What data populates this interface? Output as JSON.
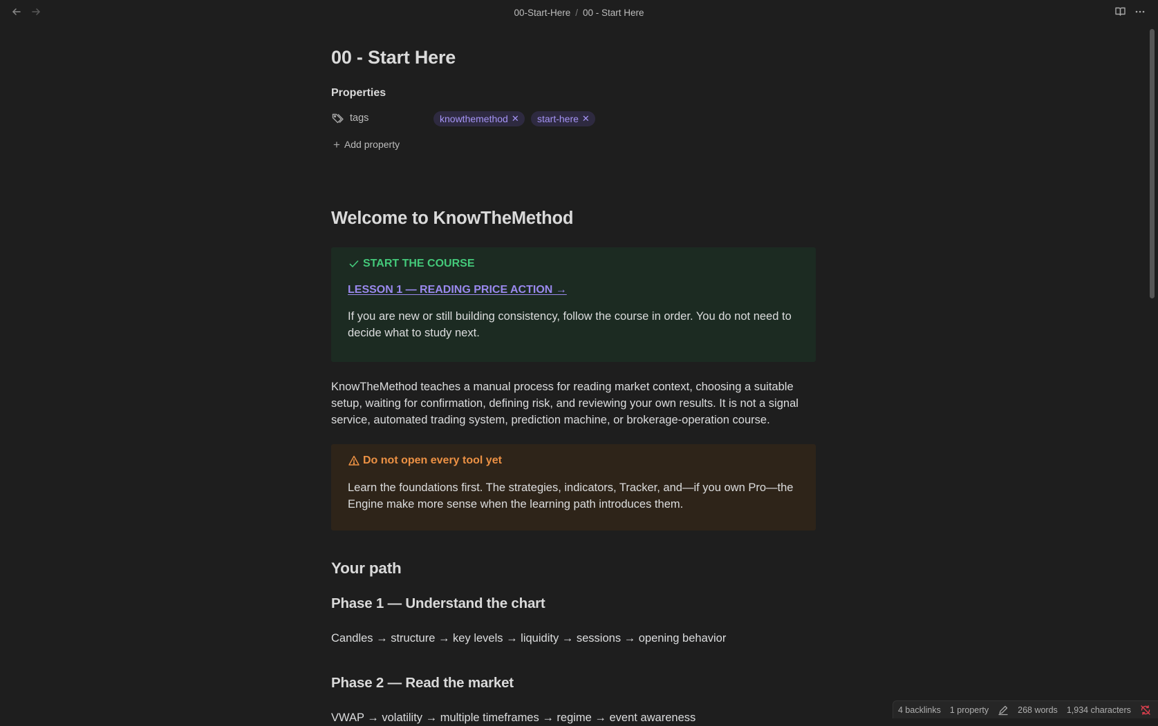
{
  "breadcrumb": {
    "folder": "00-Start-Here",
    "separator": "/",
    "note": "00 - Start Here"
  },
  "note": {
    "title": "00 - Start Here"
  },
  "properties": {
    "heading": "Properties",
    "tags_key": "tags",
    "tags": [
      "knowthemethod",
      "start-here"
    ],
    "add_property_label": "Add property"
  },
  "content": {
    "welcome_heading": "Welcome to KnowTheMethod",
    "course_callout": {
      "title": "START THE COURSE",
      "link": "LESSON 1 — READING PRICE ACTION →",
      "body": "If you are new or still building consistency, follow the course in order. You do not need to decide what to study next."
    },
    "intro_paragraph": "KnowTheMethod teaches a manual process for reading market context, choosing a suitable setup, waiting for confirmation, defining risk, and reviewing your own results. It is not a signal service, automated trading system, prediction machine, or brokerage-operation course.",
    "warning_callout": {
      "title": "Do not open every tool yet",
      "body": "Learn the foundations first. The strategies, indicators, Tracker, and—if you own Pro—the Engine make more sense when the learning path introduces them."
    },
    "path_heading": "Your path",
    "phase1_heading": "Phase 1 — Understand the chart",
    "phase1_text": "Candles → structure → key levels → liquidity → sessions → opening behavior",
    "phase2_heading": "Phase 2 — Read the market",
    "phase2_text": "VWAP → volatility → multiple timeframes → regime → event awareness"
  },
  "statusbar": {
    "backlinks": "4 backlinks",
    "properties": "1 property",
    "words": "268 words",
    "characters": "1,934 characters"
  },
  "icons": {
    "back": "arrow-left-icon",
    "forward": "arrow-right-icon",
    "reading_mode": "book-open-icon",
    "more": "more-horizontal-icon",
    "tags": "tags-icon",
    "add": "plus-icon",
    "success": "check-icon",
    "warning": "alert-triangle-icon",
    "edit": "pencil-icon",
    "sync": "sync-off-icon"
  },
  "colors": {
    "background": "#1e1e1e",
    "tag_text": "#a594f5",
    "tag_bg": "#2e2a40",
    "success": "#44c97a",
    "success_bg": "#1c2b22",
    "warning": "#ec9144",
    "warning_bg": "#2e2419",
    "link": "#9a89ee",
    "sync_error": "#e0404f"
  }
}
